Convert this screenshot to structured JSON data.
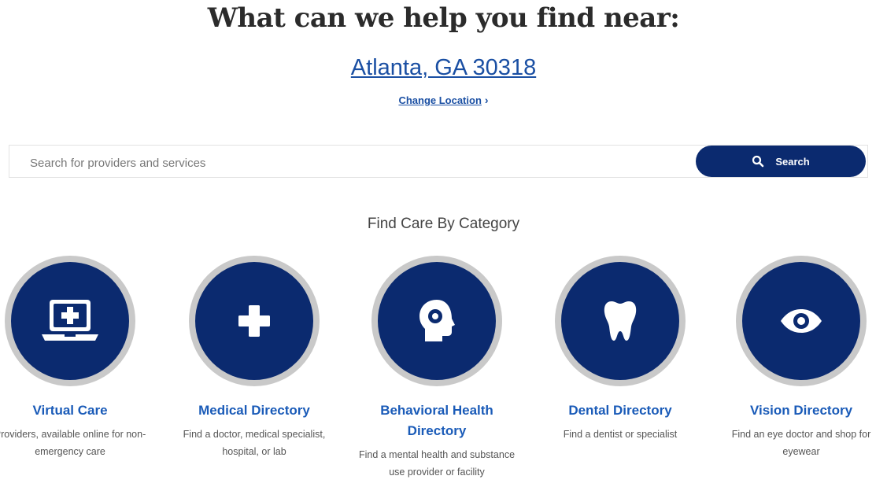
{
  "header": {
    "title": "What can we help you find near:",
    "location": "Atlanta, GA 30318",
    "change_location": "Change Location"
  },
  "search": {
    "placeholder": "Search for providers and services",
    "button_label": "Search"
  },
  "categories_section": {
    "title": "Find Care By Category",
    "items": [
      {
        "title": "Virtual Care",
        "description": "Providers, available online for non-emergency care",
        "icon": "laptop-medical-icon"
      },
      {
        "title": "Medical Directory",
        "description": "Find a doctor, medical specialist, hospital, or lab",
        "icon": "medical-cross-icon"
      },
      {
        "title": "Behavioral Health Directory",
        "description": "Find a mental health and substance use provider or facility",
        "icon": "head-profile-icon"
      },
      {
        "title": "Dental Directory",
        "description": "Find a dentist or specialist",
        "icon": "tooth-icon"
      },
      {
        "title": "Vision Directory",
        "description": "Find an eye doctor and shop for eyewear",
        "icon": "eye-icon"
      }
    ]
  },
  "colors": {
    "primary_navy": "#0b2a6f",
    "link_blue": "#1a5bb8",
    "circle_ring": "#c9c9c9"
  }
}
